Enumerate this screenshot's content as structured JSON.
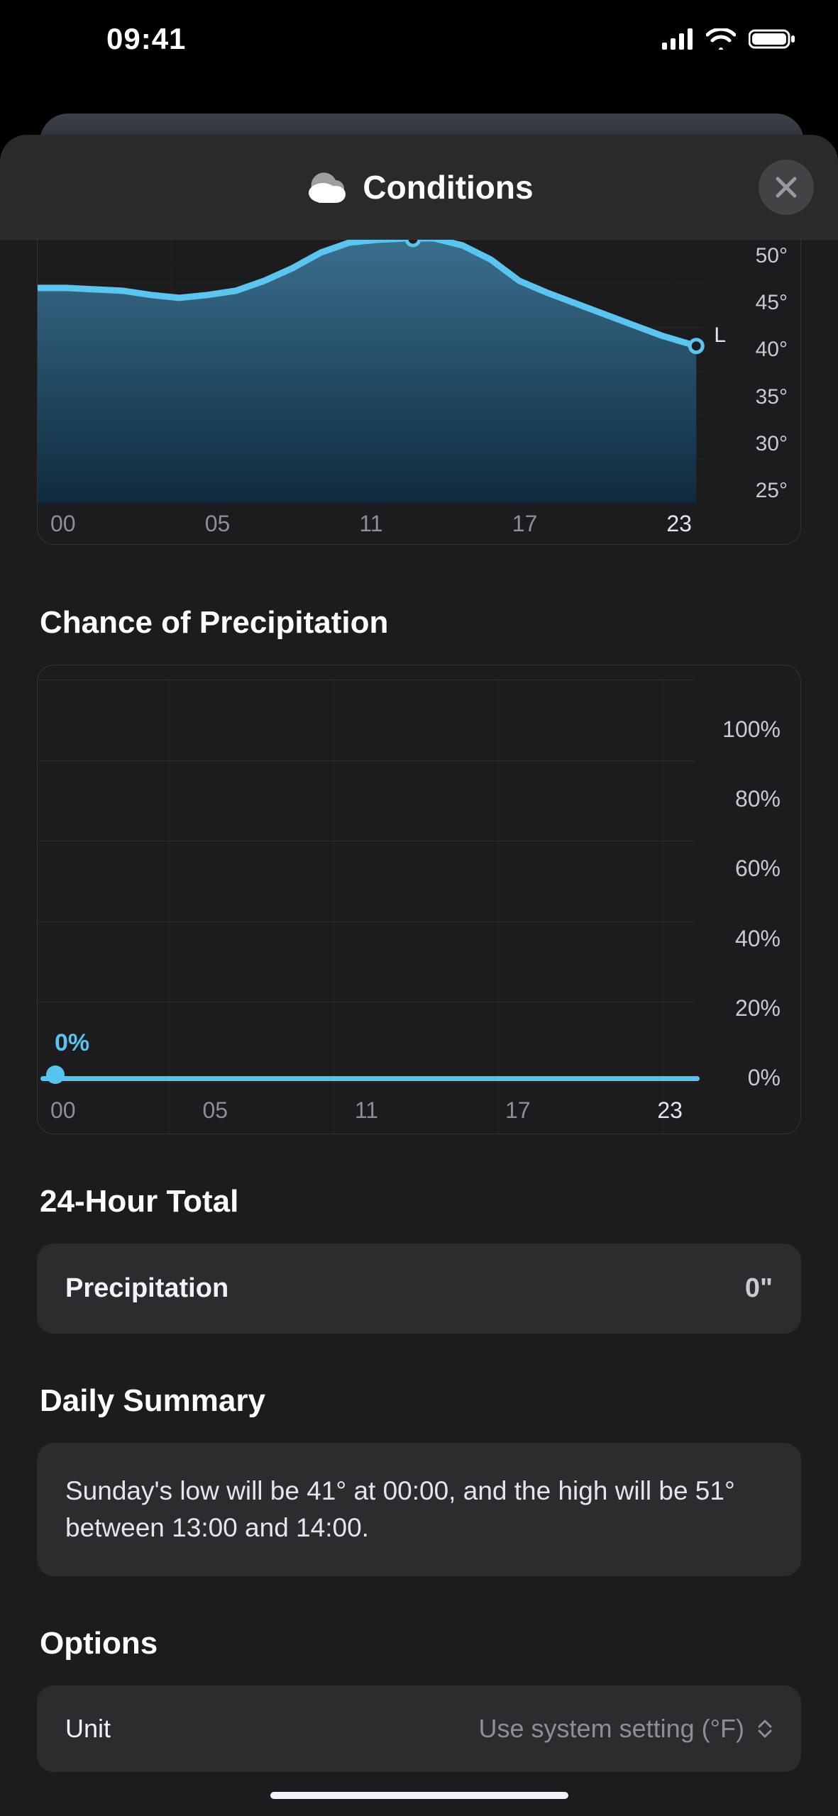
{
  "statusbar": {
    "time": "09:41"
  },
  "sheet": {
    "title": "Conditions"
  },
  "chart_data": [
    {
      "type": "area",
      "name": "temperature",
      "x_hours": [
        0,
        1,
        2,
        3,
        4,
        5,
        6,
        7,
        8,
        9,
        10,
        11,
        12,
        13,
        14,
        15,
        16,
        17,
        18,
        19,
        20,
        21,
        22,
        23
      ],
      "values": [
        46,
        46,
        46,
        45.5,
        45,
        45,
        45.5,
        46,
        47,
        48,
        50,
        50.5,
        51,
        51,
        51,
        50,
        49,
        47,
        46,
        45,
        44,
        43,
        42,
        41
      ],
      "low_marker": "L",
      "ylim": [
        25,
        50
      ],
      "y_ticks": [
        "50°",
        "45°",
        "40°",
        "35°",
        "30°",
        "25°"
      ],
      "x_ticks": [
        "00",
        "05",
        "11",
        "17",
        "23"
      ]
    },
    {
      "type": "line",
      "name": "precipitation_chance",
      "title": "Chance of Precipitation",
      "x_hours": [
        0,
        1,
        2,
        3,
        4,
        5,
        6,
        7,
        8,
        9,
        10,
        11,
        12,
        13,
        14,
        15,
        16,
        17,
        18,
        19,
        20,
        21,
        22,
        23
      ],
      "values": [
        0,
        0,
        0,
        0,
        0,
        0,
        0,
        0,
        0,
        0,
        0,
        0,
        0,
        0,
        0,
        0,
        0,
        0,
        0,
        0,
        0,
        0,
        0,
        0
      ],
      "current_label": "0%",
      "ylim": [
        0,
        100
      ],
      "y_ticks": [
        "100%",
        "80%",
        "60%",
        "40%",
        "20%",
        "0%"
      ],
      "x_ticks": [
        "00",
        "05",
        "11",
        "17",
        "23"
      ]
    }
  ],
  "sections": {
    "precip_heading": "Chance of Precipitation",
    "total_heading": "24-Hour Total",
    "summary_heading": "Daily Summary",
    "options_heading": "Options"
  },
  "total": {
    "label": "Precipitation",
    "value": "0\""
  },
  "summary": {
    "text": "Sunday's low will be 41° at 00:00, and the high will be 51° between 13:00 and 14:00."
  },
  "options": {
    "unit_label": "Unit",
    "unit_value": "Use system setting (°F)"
  }
}
